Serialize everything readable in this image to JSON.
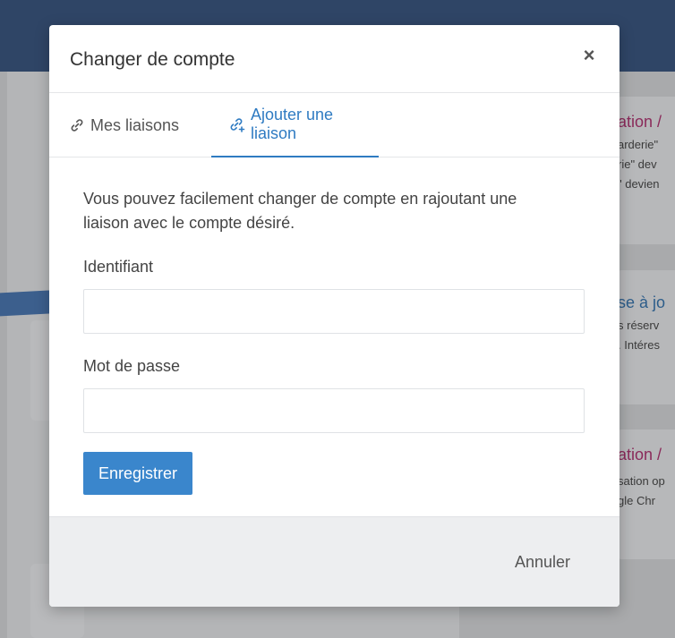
{
  "background": {
    "cards": [
      {
        "title": "ation /",
        "lines": [
          "arderie\"",
          "rie\" dev",
          "\" devien"
        ]
      },
      {
        "title": "se à jo",
        "lines": [
          "s réserv",
          ". Intéres"
        ]
      },
      {
        "title": "ation /",
        "lines": [
          "sation op",
          "gle Chr"
        ]
      }
    ]
  },
  "modal": {
    "title": "Changer de compte",
    "close_symbol": "×",
    "tabs": [
      {
        "label": "Mes liaisons",
        "icon": "link-icon",
        "active": false
      },
      {
        "label": "Ajouter une liaison",
        "icon": "add-link-icon",
        "active": true
      }
    ],
    "intro": "Vous pouvez facilement changer de compte en rajoutant une liaison avec le compte désiré.",
    "identifier_label": "Identifiant",
    "identifier_value": "",
    "password_label": "Mot de passe",
    "password_value": "",
    "save_label": "Enregistrer",
    "cancel_label": "Annuler"
  },
  "colors": {
    "accent": "#2f7bc2",
    "button": "#3a86cc",
    "header_bg": "#2f4566"
  }
}
